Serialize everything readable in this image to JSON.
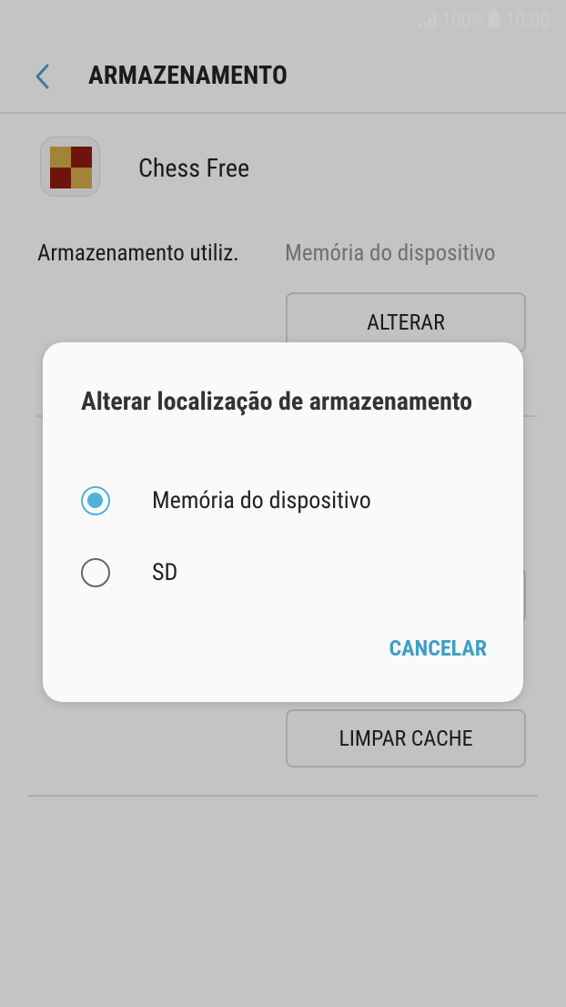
{
  "status_bar": {
    "battery": "100%",
    "time": "10:00"
  },
  "app_bar": {
    "title": "ARMAZENAMENTO"
  },
  "app": {
    "name": "Chess Free"
  },
  "storage": {
    "label": "Armazenamento utiliz.",
    "value": "Memória do dispositivo",
    "change_button": "ALTERAR"
  },
  "clear_cache_button": "LIMPAR CACHE",
  "dialog": {
    "title": "Alterar localização de armazenamento",
    "options": [
      {
        "label": "Memória do dispositivo",
        "selected": true
      },
      {
        "label": "SD",
        "selected": false
      }
    ],
    "cancel_label": "CANCELAR"
  },
  "colors": {
    "accent": "#4fb3d9",
    "accent_text": "#3f9fc6"
  }
}
